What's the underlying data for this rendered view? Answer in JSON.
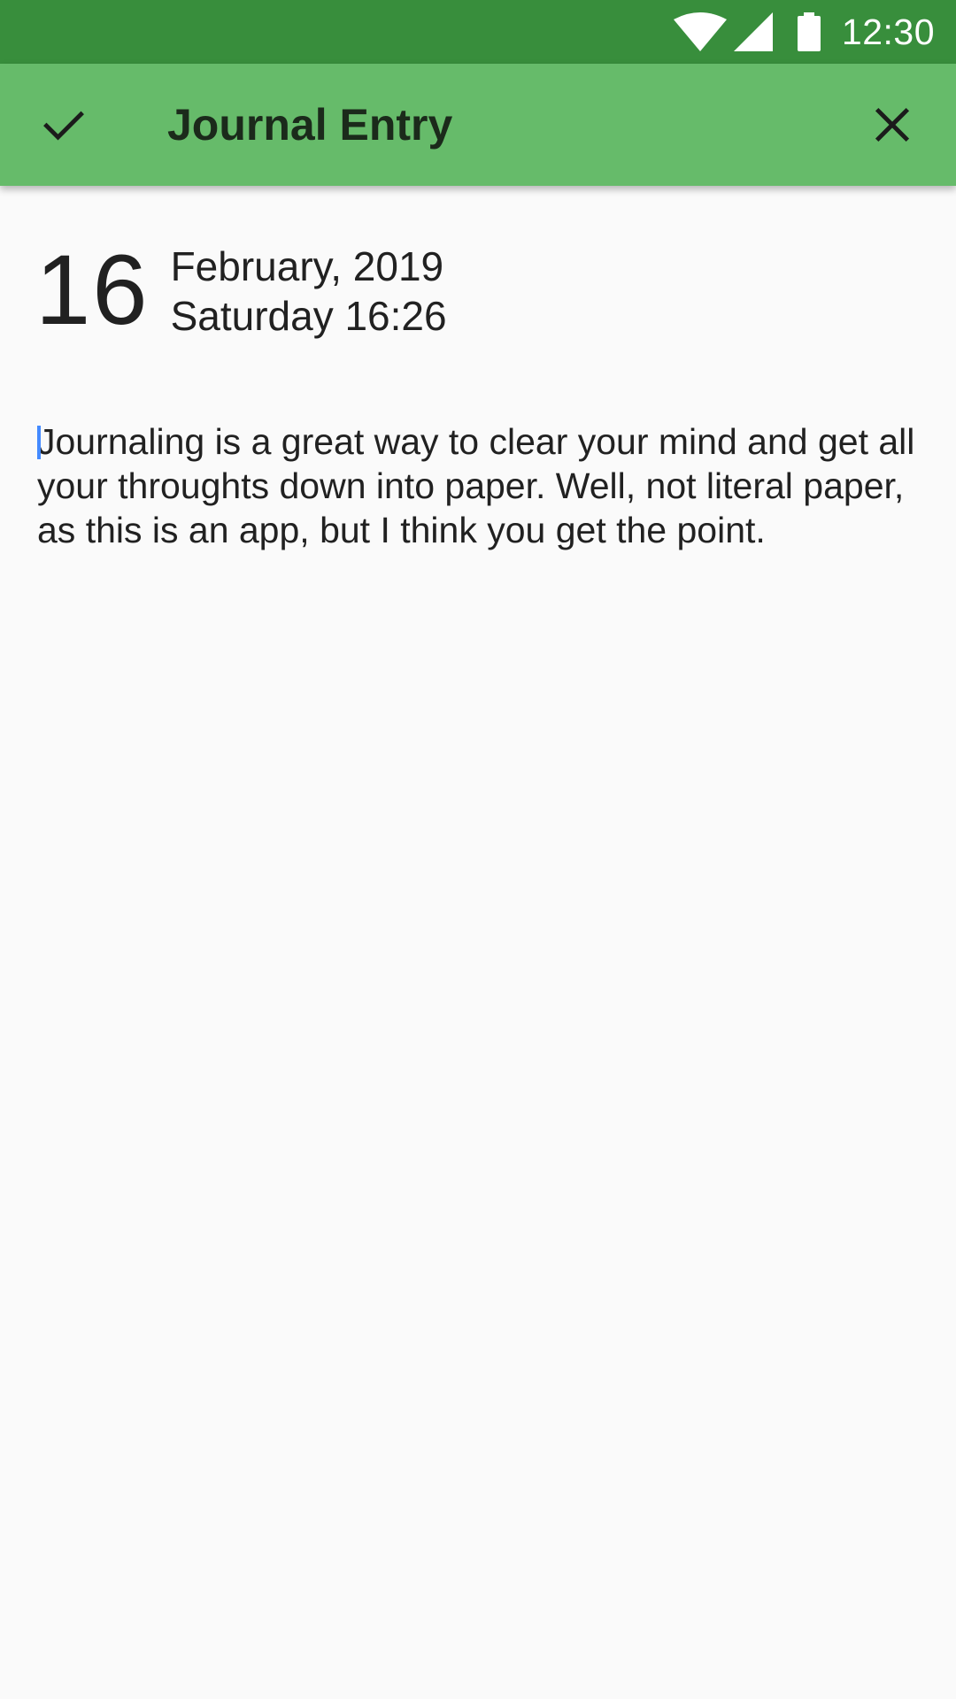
{
  "status_bar": {
    "time": "12:30",
    "icons": [
      "wifi-icon",
      "signal-icon",
      "battery-icon"
    ]
  },
  "app_bar": {
    "title": "Journal Entry",
    "left_icon": "checkmark-icon",
    "right_icon": "close-icon"
  },
  "entry": {
    "day": "16",
    "month_year": "February, 2019",
    "weekday_time": "Saturday 16:26",
    "body": "Journaling is a great way to clear your mind and get all your throughts down into paper. Well, not literal paper, as this is an app, but I think you get the point."
  },
  "colors": {
    "status_bar": "#388e3c",
    "app_bar": "#66bb6a",
    "background": "#fafafa",
    "cursor": "#448aff"
  }
}
